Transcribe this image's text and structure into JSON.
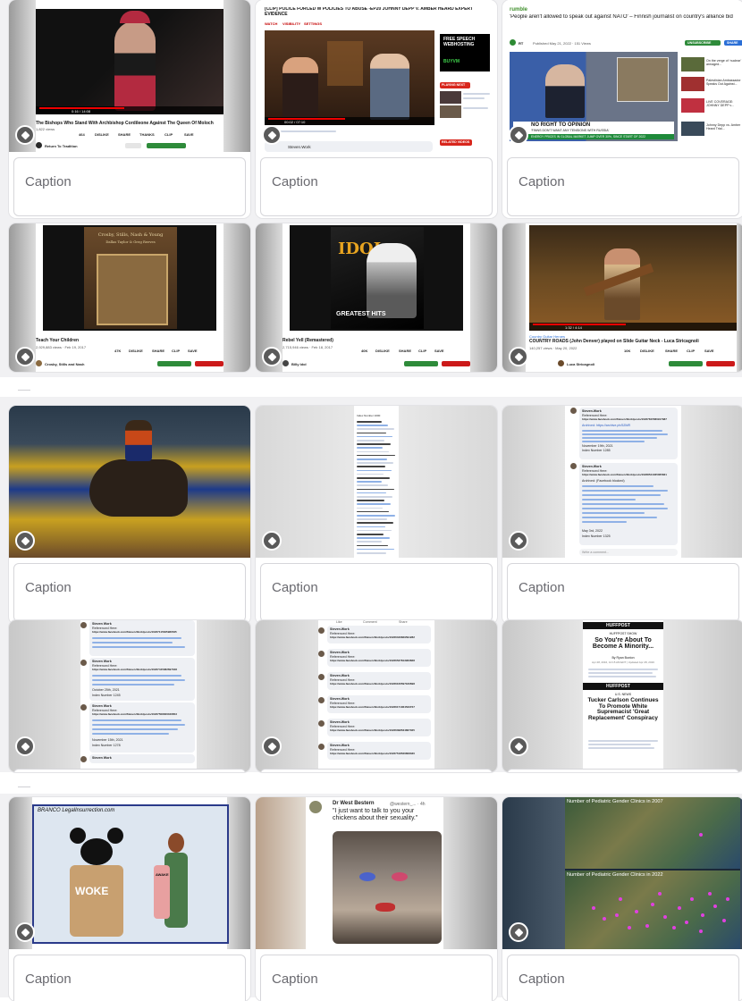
{
  "caption_placeholder": "Caption",
  "cards": {
    "c1": {
      "title": "The Bishops Who Stand With Archbishop Cordileone Against The Queen Of Moloch",
      "views": "1,822 views",
      "actions": [
        "464",
        "DISLIKE",
        "SHARE",
        "THANKS",
        "CLIP",
        "SAVE"
      ],
      "channel": "Return To Tradition",
      "time": "0:16 / 14:08"
    },
    "c2": {
      "title": "[CLIP] POLICE FORCED W POLICIES TO ABUSE -EP20 JOHNNY DEPP V. AMBER HEARD EXPERT EVIDENCE",
      "tabs": [
        "WATCH",
        "VISIBILITY",
        "SETTINGS"
      ],
      "ad_text": "FREE SPEECH WEBHOSTING",
      "ad_brand": "BUYVM",
      "playing_next": "PLAYING NEXT",
      "related": "RELATED VIDEOS",
      "commenter": "Steven.Work",
      "time": "00:02 / 07:10"
    },
    "c3": {
      "site": "rumble",
      "title": "'People aren't allowed to speak out against NATO' – Finnish journalist on country's alliance bid",
      "channel": "RT",
      "published": "Published May 21, 2022 · 151 Views",
      "subscribe": "UNSUBSCRIBE",
      "share": "SHARE",
      "banner_title": "NO RIGHT TO OPINION",
      "banner_sub": "'FINNS DON'T WANT ANY TENSIONS WITH RUSSIA'",
      "ticker": "ENERGY PRICES IN GLOBAL MARKET JUMP OVER 30%, SINCE START OF 2022",
      "side_items": [
        "On the verge of ‘nuclear’ armaged...",
        "Palestinian Ambassador Speaks Out Against...",
        "LIVE COVERAGE: JOHNNY DEPP v...",
        "Johnny Depp vs. Amber Heard Trial..."
      ]
    },
    "c4": {
      "album_band": "Crosby, Stills, Nash & Young",
      "album_members": "Dallas Taylor & Greg Reeves",
      "title": "Teach Your Children",
      "views": "2,929,883 views · Feb 19, 2017",
      "actions": [
        "47K",
        "DISLIKE",
        "SHARE",
        "CLIP",
        "SAVE"
      ],
      "channel": "Crosby, Stills and Nash"
    },
    "c5": {
      "album_top": "IDOL",
      "album_bottom": "GREATEST HITS",
      "title": "Rebel Yell (Remastered)",
      "views": "2,715,946 views · Feb 18, 2017",
      "actions": [
        "40K",
        "DISLIKE",
        "SHARE",
        "CLIP",
        "SAVE"
      ],
      "channel": "Billy Idol"
    },
    "c6": {
      "channel_small": "Country Guitar Heroes",
      "title": "COUNTRY ROADS (John Denver) played on Slide Guitar Neck - Luca Stricagnoli",
      "views": "140,257 views · May 20, 2022",
      "actions": [
        "10K",
        "DISLIKE",
        "SHARE",
        "CLIP",
        "SAVE"
      ],
      "channel": "Luca Stricagnoli",
      "time": "1:32 / 4:14"
    },
    "c8": {
      "header": "Index Number 1000"
    },
    "c9": {
      "author": "Steven.Work",
      "label_ref": "Referenced Here:",
      "fb_url": "https://www.facebook.com/Steven.Work/posts/10227815580917387",
      "archived": "Archived: https://archive.ph/5ZfdR",
      "date1": "November 19th, 2021",
      "index1": "Index Number 1285",
      "fb_url2": "https://www.facebook.com/Steven.Work/posts/10228544465065831",
      "archived2": "Archived: (Facebook blocked)",
      "date2": "May 3rd, 2022",
      "index2": "Index Number 1325",
      "write": "Write a comment..."
    },
    "c10": {
      "author": "Steven Work",
      "label_ref": "Referenced Here:",
      "fb1": "https://www.facebook.com/Steven.Work/posts/10227115635980535",
      "fb2": "https://www.facebook.com/Steven.Work/posts/10227445082697048",
      "date": "October 25th, 2021",
      "index": "Index Number 1245",
      "fb3": "https://www.facebook.com/Steven.Work/posts/10227508306046653",
      "date2": "November 15th, 2021",
      "index2": "Index Number 1278"
    },
    "c11": {
      "bar": [
        "Like",
        "Comment",
        "Share"
      ],
      "author": "Steven.Work",
      "label_ref": "Referenced Here:",
      "urls": [
        "https://www.facebook.com/Steven.Work/posts/10226346829591282",
        "https://www.facebook.com/Steven.Work/posts/10226537813963828",
        "https://www.facebook.com/Steven.Work/posts/10226166597183698",
        "https://www.facebook.com/Steven.Work/posts/10226171064533727",
        "https://www.facebook.com/Steven.Work/posts/10226398534867025",
        "https://www.facebook.com/Steven.Work/posts/10227518526808330"
      ]
    },
    "c12": {
      "brand": "HUFFPOST",
      "section1": "HUFFPOST SHOW",
      "headline1": "So You're About To Become A Minority...",
      "byline1": "By Ryan Buxton",
      "date1": "Apr 28, 2016, 12:15 AM EDT | Updated Apr 28, 2016",
      "section2": "U.S. NEWS",
      "headline2": "Tucker Carlson Continues To Promote White Supremacist 'Great Replacement' Conspiracy"
    },
    "c13": {
      "credit": "BRANCO LegalInsurrection.com",
      "left_label": "WOKE",
      "right_label": "AWAKE"
    },
    "c14": {
      "name": "Dr West Bestern",
      "handle": "@western_... · 4h",
      "tweet": "\"I just want to talk to you your chickens about their sexuality.\""
    },
    "c15": {
      "title_top": "Number of Pediatric Gender Clinics in 2007",
      "title_bottom": "Number of Pediatric Gender Clinics in 2022"
    }
  }
}
